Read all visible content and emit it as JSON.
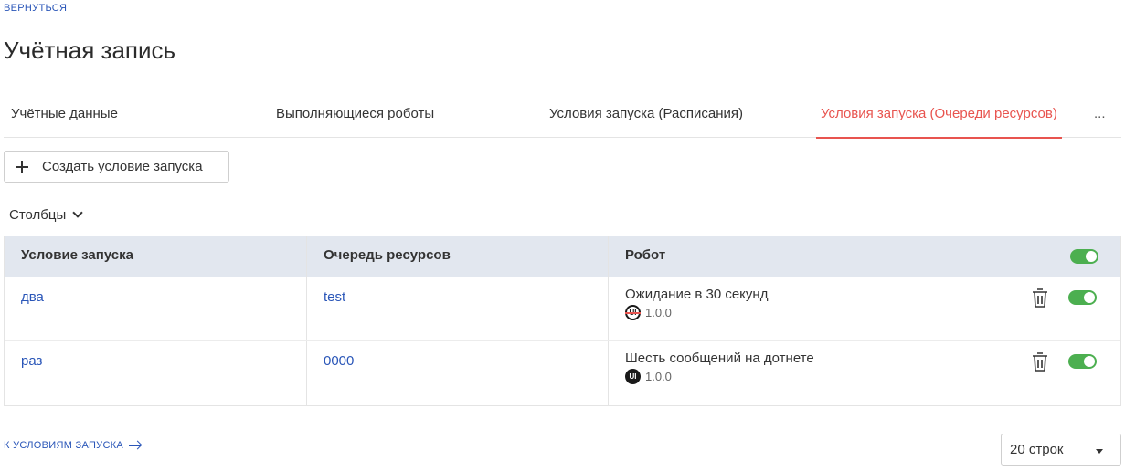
{
  "nav": {
    "back_label": "ВЕРНУТЬСЯ"
  },
  "page": {
    "title": "Учётная запись"
  },
  "tabs": [
    {
      "label": "Учётные данные",
      "active": false
    },
    {
      "label": "Выполняющиеся роботы",
      "active": false
    },
    {
      "label": "Условия запуска (Расписания)",
      "active": false
    },
    {
      "label": "Условия запуска (Очереди ресурсов)",
      "active": true
    }
  ],
  "tabs_more": "...",
  "toolbar": {
    "create_label": "Создать условие запуска"
  },
  "columns_menu": {
    "label": "Столбцы"
  },
  "table": {
    "headers": [
      "Условие запуска",
      "Очередь ресурсов",
      "Робот"
    ],
    "header_toggle_on": true,
    "rows": [
      {
        "condition": "два",
        "queue": "test",
        "robot_name": "Ожидание в 30 секунд",
        "robot_version": "1.0.0",
        "robot_logo": "UI",
        "enabled": true
      },
      {
        "condition": "раз",
        "queue": "0000",
        "robot_name": "Шесть сообщений на дотнете",
        "robot_version": "1.0.0",
        "robot_logo": "UI",
        "enabled": true
      }
    ]
  },
  "footer": {
    "link_label": "К УСЛОВИЯМ ЗАПУСКА",
    "rows_per_page": "20 строк"
  },
  "colors": {
    "accent": "#e8544f",
    "link": "#2a56b8",
    "toggle_on": "#4caf50",
    "header_bg": "#e2e7ef"
  },
  "icons": [
    "plus-icon",
    "chevron-down-icon",
    "trash-icon",
    "arrow-right-icon",
    "caret-down-icon",
    "ui-robot-logo"
  ]
}
